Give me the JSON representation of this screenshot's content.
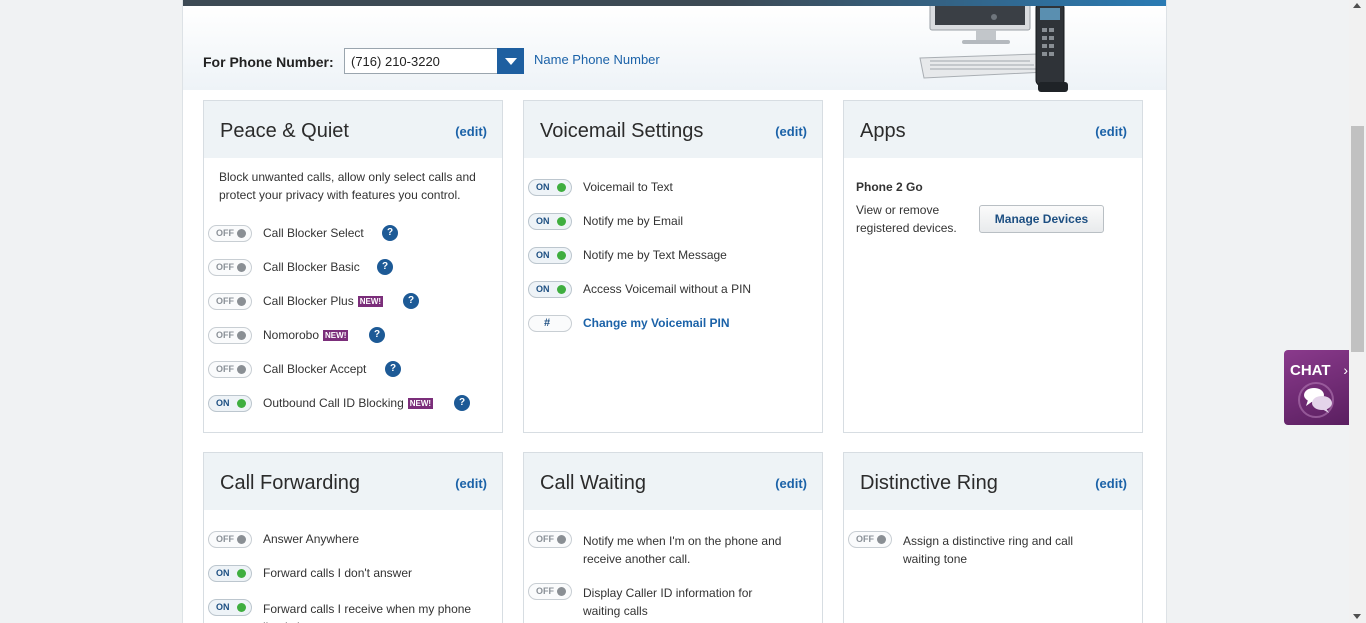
{
  "phone_bar": {
    "label": "For Phone Number:",
    "selected_number": "(716) 210-3220",
    "name_link": "Name Phone Number"
  },
  "cards": {
    "peace": {
      "title": "Peace & Quiet",
      "edit": "(edit)",
      "description": "Block unwanted calls, allow only select calls and protect your privacy with features you control.",
      "rows": [
        {
          "state": "OFF",
          "label": "Call Blocker Select"
        },
        {
          "state": "OFF",
          "label": "Call Blocker Basic"
        },
        {
          "state": "OFF",
          "label": "Call Blocker Plus",
          "badge": "NEW!"
        },
        {
          "state": "OFF",
          "label": "Nomorobo",
          "badge": "NEW!"
        },
        {
          "state": "OFF",
          "label": "Call Blocker Accept"
        },
        {
          "state": "ON",
          "label": "Outbound Call ID Blocking",
          "badge": "NEW!"
        }
      ]
    },
    "voicemail": {
      "title": "Voicemail Settings",
      "edit": "(edit)",
      "rows": [
        {
          "state": "ON",
          "label": "Voicemail to Text"
        },
        {
          "state": "ON",
          "label": "Notify me by Email"
        },
        {
          "state": "ON",
          "label": "Notify me by Text Message"
        },
        {
          "state": "ON",
          "label": "Access Voicemail without a PIN"
        },
        {
          "state": "#",
          "label": "Change my Voicemail PIN"
        }
      ]
    },
    "apps": {
      "title": "Apps",
      "edit": "(edit)",
      "subtitle": "Phone 2 Go",
      "description": "View or remove registered devices.",
      "button": "Manage Devices"
    },
    "forwarding": {
      "title": "Call Forwarding",
      "edit": "(edit)",
      "rows": [
        {
          "state": "OFF",
          "label": "Answer Anywhere"
        },
        {
          "state": "ON",
          "label": "Forward calls I don't answer"
        },
        {
          "state": "ON",
          "label": "Forward calls I receive when my phone line is busy"
        }
      ]
    },
    "waiting": {
      "title": "Call Waiting",
      "edit": "(edit)",
      "rows": [
        {
          "state": "OFF",
          "label": "Notify me when I'm on the phone and receive another call."
        },
        {
          "state": "OFF",
          "label": "Display Caller ID information for waiting calls"
        }
      ]
    },
    "ring": {
      "title": "Distinctive Ring",
      "edit": "(edit)",
      "rows": [
        {
          "state": "OFF",
          "label": "Assign a distinctive ring and call waiting tone"
        }
      ]
    }
  },
  "help_glyph": "?",
  "chat": {
    "label": "CHAT",
    "chevron": "›"
  },
  "colors": {
    "link": "#1b62a8",
    "on_dot": "#3fae3f",
    "off_dot": "#8a8f94",
    "badge": "#7b2e7a",
    "chat": "#7a2f7c"
  }
}
